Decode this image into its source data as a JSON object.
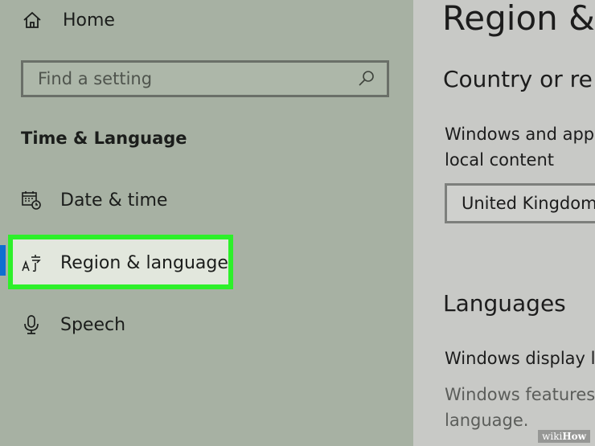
{
  "sidebar": {
    "home_label": "Home",
    "search": {
      "placeholder": "Find a setting"
    },
    "section_title": "Time & Language",
    "items": [
      {
        "label": "Date & time",
        "icon": "calendar-clock-icon"
      },
      {
        "label": "Region & language",
        "icon": "language-icon",
        "selected": true
      },
      {
        "label": "Speech",
        "icon": "microphone-icon"
      }
    ]
  },
  "main": {
    "title": "Region &",
    "country_heading": "Country or re",
    "country_description": "Windows and app local content",
    "country_value": "United Kingdom",
    "languages_heading": "Languages",
    "display_language_text": "Windows display l",
    "features_text": "Windows features language."
  },
  "watermark": {
    "wiki": "wiki",
    "how": "How"
  },
  "colors": {
    "highlight_border": "#2df02a",
    "active_indicator": "#0f6fd0"
  }
}
